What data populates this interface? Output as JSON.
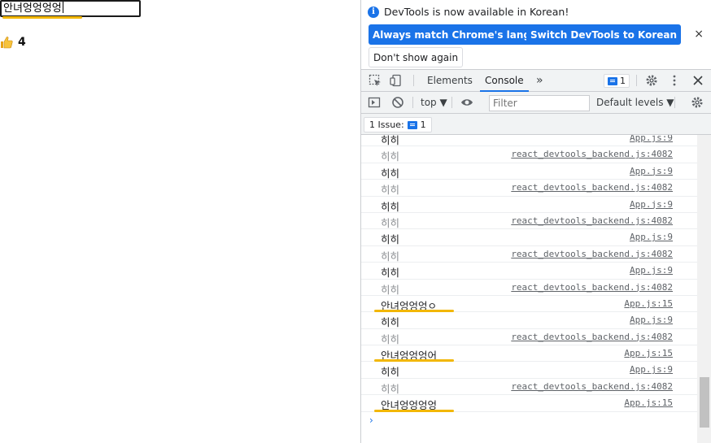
{
  "page": {
    "input_value": "안녀엉엉엉엉",
    "like_icon": "thumbs-up-icon",
    "like_count": "4",
    "accent_color": "#f2b705"
  },
  "devtools": {
    "infobar": {
      "message": "DevTools is now available in Korean!",
      "btn_match": "Always match Chrome's language",
      "btn_switch": "Switch DevTools to Korean",
      "btn_dont_show": "Don't show again",
      "close": "×"
    },
    "tabs": {
      "elements": "Elements",
      "console": "Console",
      "more": "»",
      "issues_count": "1"
    },
    "toolbar": {
      "context": "top ▼",
      "filter_placeholder": "Filter",
      "levels": "Default levels ▼"
    },
    "issues": {
      "label": "1 Issue:",
      "count": "1"
    },
    "console_rows": [
      {
        "msg": "히히",
        "src": "App.js:9",
        "dim": false
      },
      {
        "msg": "히히",
        "src": "react_devtools_backend.js:4082",
        "dim": true
      },
      {
        "msg": "히히",
        "src": "App.js:9",
        "dim": false
      },
      {
        "msg": "히히",
        "src": "react_devtools_backend.js:4082",
        "dim": true
      },
      {
        "msg": "히히",
        "src": "App.js:9",
        "dim": false
      },
      {
        "msg": "히히",
        "src": "react_devtools_backend.js:4082",
        "dim": true
      },
      {
        "msg": "히히",
        "src": "App.js:9",
        "dim": false
      },
      {
        "msg": "히히",
        "src": "react_devtools_backend.js:4082",
        "dim": true
      },
      {
        "msg": "히히",
        "src": "App.js:9",
        "dim": false
      },
      {
        "msg": "히히",
        "src": "react_devtools_backend.js:4082",
        "dim": true
      },
      {
        "msg": "안녀엉엉엉ㅇ",
        "src": "App.js:15",
        "dim": false,
        "highlight": true
      },
      {
        "msg": "히히",
        "src": "App.js:9",
        "dim": false
      },
      {
        "msg": "히히",
        "src": "react_devtools_backend.js:4082",
        "dim": true
      },
      {
        "msg": "안녀엉엉엉어",
        "src": "App.js:15",
        "dim": false,
        "highlight": true
      },
      {
        "msg": "히히",
        "src": "App.js:9",
        "dim": false
      },
      {
        "msg": "히히",
        "src": "react_devtools_backend.js:4082",
        "dim": true
      },
      {
        "msg": "안녀엉엉엉엉",
        "src": "App.js:15",
        "dim": false,
        "highlight": true
      }
    ],
    "prompt": "›"
  }
}
